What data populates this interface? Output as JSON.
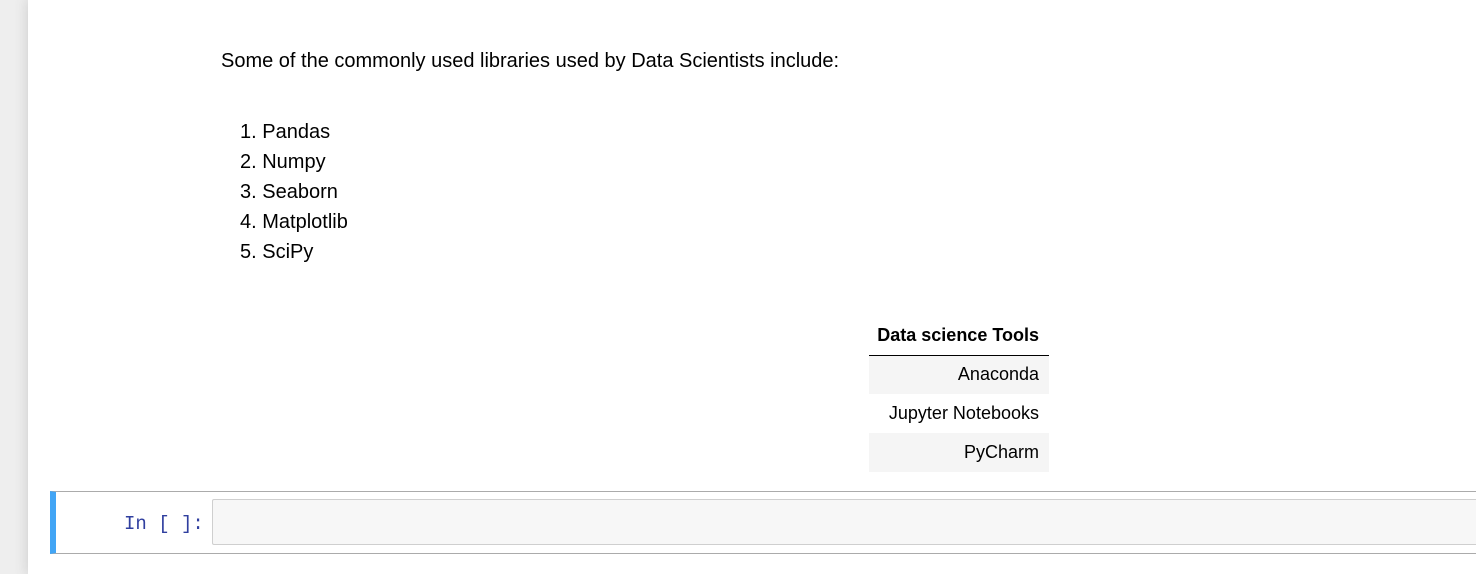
{
  "markdown_cell": {
    "intro": "Some of the commonly used libraries used by Data Scientists include:",
    "libraries": [
      "1. Pandas",
      "2. Numpy",
      "3. Seaborn",
      "4. Matplotlib",
      "5. SciPy"
    ],
    "tools_table": {
      "header": "Data science Tools",
      "rows": [
        "Anaconda",
        "Jupyter Notebooks",
        "PyCharm"
      ]
    }
  },
  "code_cell": {
    "prompt": "In [ ]:",
    "value": ""
  },
  "colors": {
    "selected_cell_border": "#42a5f5",
    "prompt_color": "#303f9f",
    "input_background": "#f7f7f7",
    "table_stripe": "#f5f5f5"
  }
}
